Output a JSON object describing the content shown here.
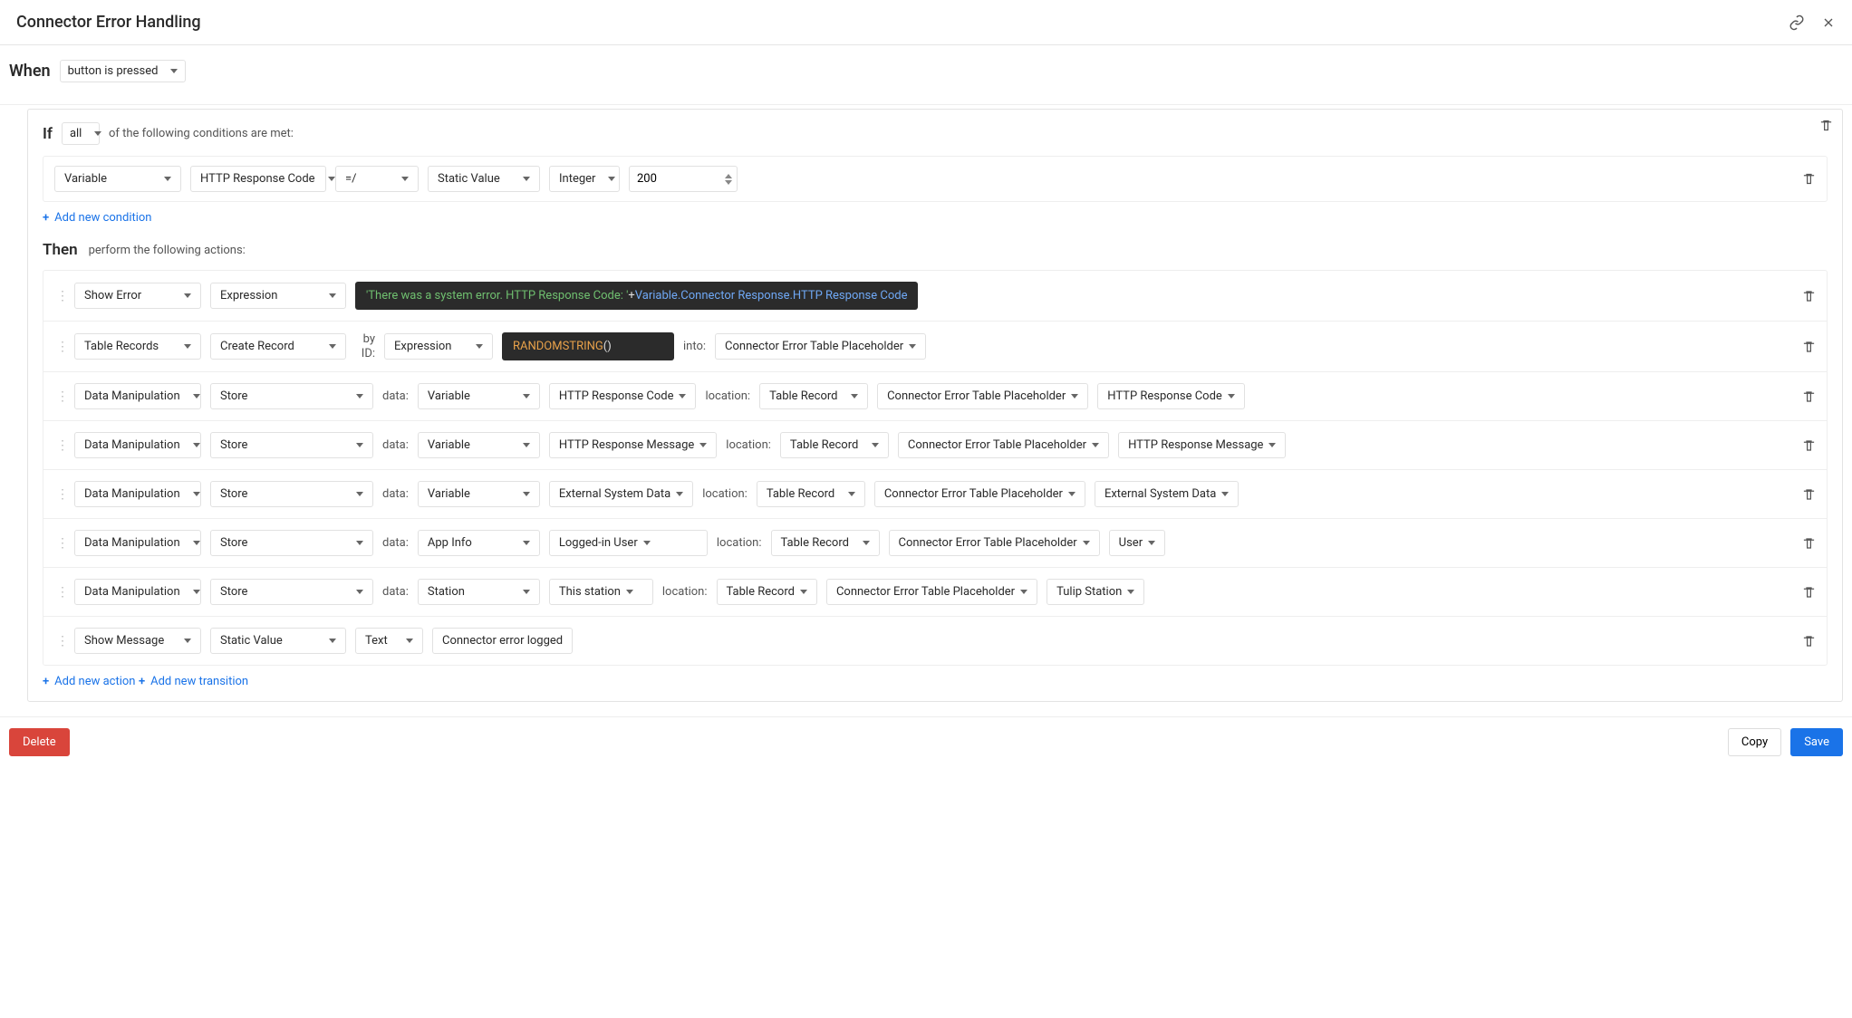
{
  "header": {
    "title": "Connector Error Handling"
  },
  "when": {
    "label": "When",
    "trigger": "button is pressed"
  },
  "if": {
    "label": "If",
    "quantifier": "all",
    "suffix": "of the following conditions are met:"
  },
  "condition": {
    "left": "Variable",
    "field": "HTTP Response Code",
    "op": "=/",
    "rhsType": "Static Value",
    "rhsKind": "Integer",
    "value": "200"
  },
  "addCondition": "Add new condition",
  "then": {
    "label": "Then",
    "suffix": "perform the following actions:"
  },
  "actions": [
    {
      "type": "Show Error",
      "mode": "Expression",
      "exprGreen": "'There was a system error. HTTP Response Code: '",
      "exprPlus": " + ",
      "exprBlue": "Variable.Connector Response.HTTP Response Code"
    },
    {
      "type": "Table Records",
      "mode": "Create Record",
      "lbl_byid": "by ID:",
      "idMode": "Expression",
      "exprOrange": "RANDOMSTRING",
      "exprTail": "()",
      "lbl_into": "into:",
      "into": "Connector Error Table Placeholder"
    },
    {
      "type": "Data Manipulation",
      "mode": "Store",
      "lbl_data": "data:",
      "dataKind": "Variable",
      "dataVal": "HTTP Response Code",
      "lbl_loc": "location:",
      "loc1": "Table Record",
      "loc2": "Connector Error Table Placeholder",
      "loc3": "HTTP Response Code"
    },
    {
      "type": "Data Manipulation",
      "mode": "Store",
      "lbl_data": "data:",
      "dataKind": "Variable",
      "dataVal": "HTTP Response Message",
      "lbl_loc": "location:",
      "loc1": "Table Record",
      "loc2": "Connector Error Table Placeholder",
      "loc3": "HTTP Response Message"
    },
    {
      "type": "Data Manipulation",
      "mode": "Store",
      "lbl_data": "data:",
      "dataKind": "Variable",
      "dataVal": "External System Data",
      "lbl_loc": "location:",
      "loc1": "Table Record",
      "loc2": "Connector Error Table Placeholder",
      "loc3": "External System Data"
    },
    {
      "type": "Data Manipulation",
      "mode": "Store",
      "lbl_data": "data:",
      "dataKind": "App Info",
      "dataVal": "Logged-in User",
      "lbl_loc": "location:",
      "loc1": "Table Record",
      "loc2": "Connector Error Table Placeholder",
      "loc3": "User"
    },
    {
      "type": "Data Manipulation",
      "mode": "Store",
      "lbl_data": "data:",
      "dataKind": "Station",
      "dataVal": "This station",
      "lbl_loc": "location:",
      "loc1": "Table Record",
      "loc2": "Connector Error Table Placeholder",
      "loc3": "Tulip Station"
    },
    {
      "type": "Show Message",
      "mode": "Static Value",
      "tkind": "Text",
      "tval": "Connector error logged"
    }
  ],
  "addAction": "Add new action",
  "addTransition": "Add new transition",
  "footer": {
    "delete": "Delete",
    "copy": "Copy",
    "save": "Save"
  }
}
